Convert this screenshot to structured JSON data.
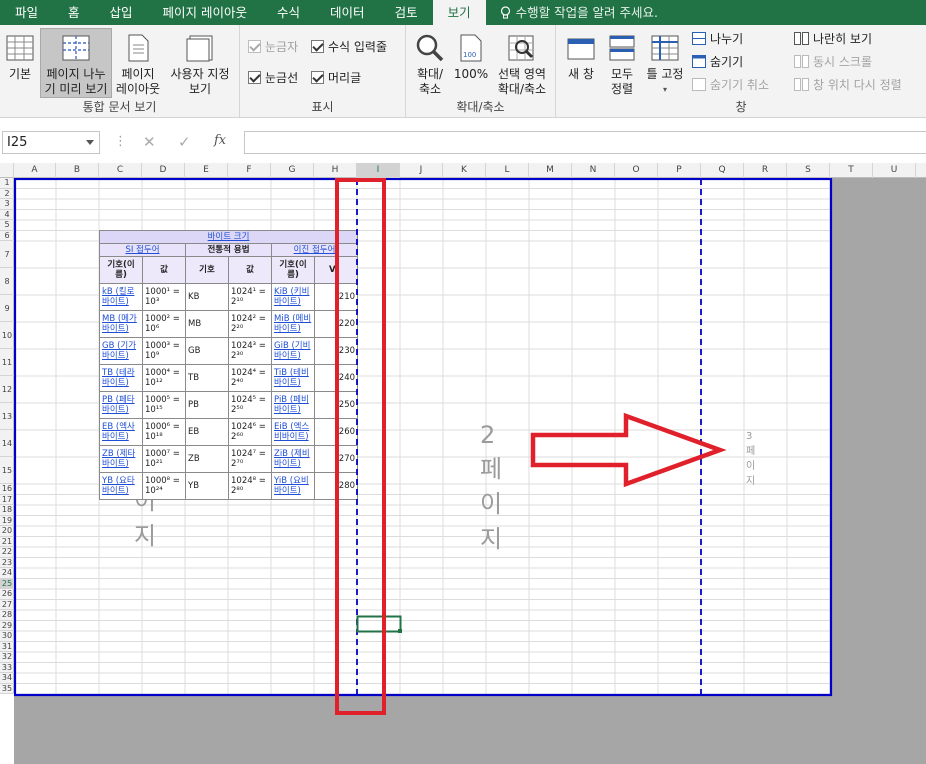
{
  "tabs": [
    "파일",
    "홈",
    "삽입",
    "페이지 레이아웃",
    "수식",
    "데이터",
    "검토",
    "보기"
  ],
  "active_tab": "보기",
  "tell_me": "수행할 작업을 알려 주세요.",
  "groups": {
    "workbook_views": {
      "label": "통합 문서 보기",
      "normal": "기본",
      "page_break_1": "페이지 나누",
      "page_break_2": "기 미리 보기",
      "page_layout_1": "페이지",
      "page_layout_2": "레이아웃",
      "custom_1": "사용자 지정",
      "custom_2": "보기"
    },
    "show": {
      "label": "표시",
      "ruler": "눈금자",
      "formula_bar": "수식 입력줄",
      "gridlines": "눈금선",
      "headings": "머리글"
    },
    "zoom": {
      "label": "확대/축소",
      "zoom_1": "확대/",
      "zoom_2": "축소",
      "hundred": "100%",
      "sel_1": "선택 영역",
      "sel_2": "확대/축소"
    },
    "window": {
      "label": "창",
      "new_window": "새 창",
      "arrange_1": "모두",
      "arrange_2": "정렬",
      "freeze": "틀 고정",
      "split": "나누기",
      "hide": "숨기기",
      "unhide": "숨기기 취소",
      "side_by_side": "나란히 보기",
      "sync_scroll": "동시 스크롤",
      "reset_pos": "창 위치 다시 정렬"
    }
  },
  "name_box": "I25",
  "columns": [
    "A",
    "B",
    "C",
    "D",
    "E",
    "F",
    "G",
    "H",
    "I",
    "J",
    "K",
    "L",
    "M",
    "N",
    "O",
    "P",
    "Q",
    "R",
    "S",
    "T",
    "U"
  ],
  "rows": [
    "1",
    "2",
    "3",
    "4",
    "5",
    "6",
    "7",
    "8",
    "9",
    "10",
    "11",
    "12",
    "13",
    "14",
    "15",
    "16",
    "17",
    "18",
    "19",
    "20",
    "21",
    "22",
    "23",
    "24",
    "25",
    "26",
    "27",
    "28",
    "29",
    "30",
    "31",
    "32",
    "33",
    "34",
    "35"
  ],
  "table": {
    "title": "바이트 크기",
    "si_header": "SI 접두어",
    "trad_header": "전통적 용법",
    "bin_header": "이진 접두어",
    "col_sym": "기호(이름)",
    "col_val": "값",
    "col_sym2": "기호",
    "col_val2": "값",
    "col_sym3": "기호(이름)",
    "col_val3": "V",
    "rows": [
      {
        "si": "kB (킬로바이트)",
        "sv": "1000¹ = 10³",
        "t": "KB",
        "tv": "1024¹ = 2¹⁰",
        "b": "KiB (키비바이트)",
        "bv": "210"
      },
      {
        "si": "MB (메가바이트)",
        "sv": "1000² = 10⁶",
        "t": "MB",
        "tv": "1024² = 2²⁰",
        "b": "MiB (메비바이트)",
        "bv": "220"
      },
      {
        "si": "GB (기가바이트)",
        "sv": "1000³ = 10⁹",
        "t": "GB",
        "tv": "1024³ = 2³⁰",
        "b": "GiB (기비바이트)",
        "bv": "230"
      },
      {
        "si": "TB (테라바이트)",
        "sv": "1000⁴ = 10¹²",
        "t": "TB",
        "tv": "1024⁴ = 2⁴⁰",
        "b": "TiB (테비바이트)",
        "bv": "240"
      },
      {
        "si": "PB (페타바이트)",
        "sv": "1000⁵ = 10¹⁵",
        "t": "PB",
        "tv": "1024⁵ = 2⁵⁰",
        "b": "PiB (페비바이트)",
        "bv": "250"
      },
      {
        "si": "EB (엑사바이트)",
        "sv": "1000⁶ = 10¹⁸",
        "t": "EB",
        "tv": "1024⁶ = 2⁶⁰",
        "b": "EiB (엑스비바이트)",
        "bv": "260"
      },
      {
        "si": "ZB (제타바이트)",
        "sv": "1000⁷ = 10²¹",
        "t": "ZB",
        "tv": "1024⁷ = 2⁷⁰",
        "b": "ZiB (제비바이트)",
        "bv": "270"
      },
      {
        "si": "YB (요타바이트)",
        "sv": "1000⁸ = 10²⁴",
        "t": "YB",
        "tv": "1024⁸ = 2⁸⁰",
        "b": "YiB (요비바이트)",
        "bv": "280"
      }
    ]
  },
  "page_labels": {
    "p1": "1 페이지",
    "p2": "2 페이지",
    "p3": "3 페이지"
  },
  "colors": {
    "accent": "#217346",
    "page_border": "#0000c8",
    "annotation": "#e0202a"
  }
}
